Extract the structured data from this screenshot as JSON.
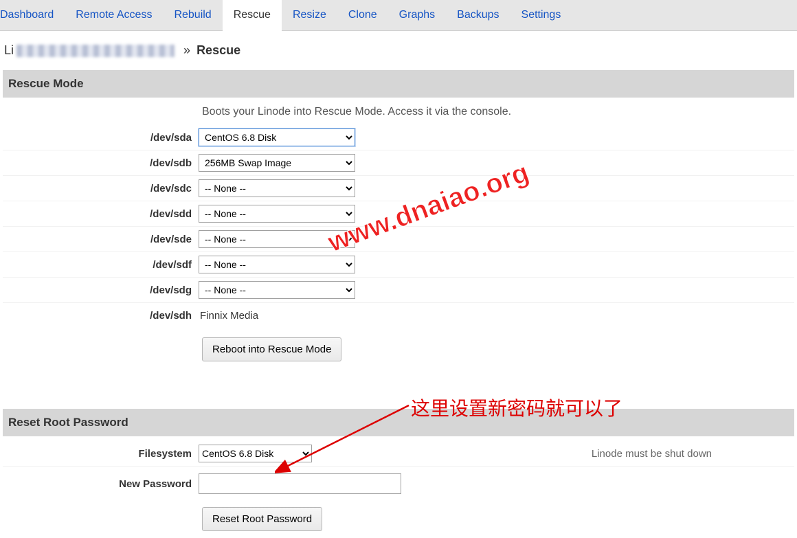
{
  "tabs": {
    "dashboard": "Dashboard",
    "remote": "Remote Access",
    "rebuild": "Rebuild",
    "rescue": "Rescue",
    "resize": "Resize",
    "clone": "Clone",
    "graphs": "Graphs",
    "backups": "Backups",
    "settings": "Settings"
  },
  "breadcrumb": {
    "prefix": "Li",
    "sep": "»",
    "current": "Rescue"
  },
  "rescue": {
    "header": "Rescue Mode",
    "desc": "Boots your Linode into Rescue Mode. Access it via the console.",
    "devices": {
      "sda": {
        "label": "/dev/sda",
        "value": "CentOS 6.8 Disk"
      },
      "sdb": {
        "label": "/dev/sdb",
        "value": "256MB Swap Image"
      },
      "sdc": {
        "label": "/dev/sdc",
        "value": "-- None --"
      },
      "sdd": {
        "label": "/dev/sdd",
        "value": "-- None --"
      },
      "sde": {
        "label": "/dev/sde",
        "value": "-- None --"
      },
      "sdf": {
        "label": "/dev/sdf",
        "value": "-- None --"
      },
      "sdg": {
        "label": "/dev/sdg",
        "value": "-- None --"
      },
      "sdh": {
        "label": "/dev/sdh",
        "value": "Finnix Media"
      }
    },
    "button": "Reboot into Rescue Mode"
  },
  "reset": {
    "header": "Reset Root Password",
    "fs_label": "Filesystem",
    "fs_value": "CentOS 6.8 Disk",
    "pw_label": "New Password",
    "hint": "Linode must be shut down",
    "button": "Reset Root Password"
  },
  "watermark": "www.dnaiao.org",
  "annotation": "这里设置新密码就可以了"
}
